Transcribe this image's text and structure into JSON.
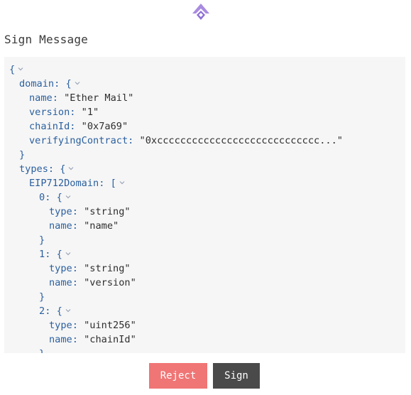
{
  "header": {
    "logo_icon": "diamond-arrow-logo",
    "logo_color": "#a98be0"
  },
  "title": "Sign Message",
  "code": {
    "lines": [
      {
        "indent": 0,
        "key": "",
        "sep": "",
        "value": "{",
        "toggle": true
      },
      {
        "indent": 1,
        "key": "domain",
        "sep": ": ",
        "value": "{",
        "toggle": true
      },
      {
        "indent": 2,
        "key": "name",
        "sep": ": ",
        "value": "\"Ether Mail\"",
        "toggle": false
      },
      {
        "indent": 2,
        "key": "version",
        "sep": ": ",
        "value": "\"1\"",
        "toggle": false
      },
      {
        "indent": 2,
        "key": "chainId",
        "sep": ": ",
        "value": "\"0x7a69\"",
        "toggle": false
      },
      {
        "indent": 2,
        "key": "verifyingContract",
        "sep": ": ",
        "value": "\"0xcccccccccccccccccccccccccccc...\"",
        "toggle": false
      },
      {
        "indent": 1,
        "key": "",
        "sep": "",
        "value": "}",
        "toggle": false
      },
      {
        "indent": 1,
        "key": "types",
        "sep": ": ",
        "value": "{",
        "toggle": true
      },
      {
        "indent": 2,
        "key": "EIP712Domain",
        "sep": ": ",
        "value": "[",
        "toggle": true
      },
      {
        "indent": 3,
        "key": "0",
        "sep": ": ",
        "value": "{",
        "toggle": true
      },
      {
        "indent": 4,
        "key": "type",
        "sep": ": ",
        "value": "\"string\"",
        "toggle": false
      },
      {
        "indent": 4,
        "key": "name",
        "sep": ": ",
        "value": "\"name\"",
        "toggle": false
      },
      {
        "indent": 3,
        "key": "",
        "sep": "",
        "value": "}",
        "toggle": false
      },
      {
        "indent": 3,
        "key": "1",
        "sep": ": ",
        "value": "{",
        "toggle": true
      },
      {
        "indent": 4,
        "key": "type",
        "sep": ": ",
        "value": "\"string\"",
        "toggle": false
      },
      {
        "indent": 4,
        "key": "name",
        "sep": ": ",
        "value": "\"version\"",
        "toggle": false
      },
      {
        "indent": 3,
        "key": "",
        "sep": "",
        "value": "}",
        "toggle": false
      },
      {
        "indent": 3,
        "key": "2",
        "sep": ": ",
        "value": "{",
        "toggle": true
      },
      {
        "indent": 4,
        "key": "type",
        "sep": ": ",
        "value": "\"uint256\"",
        "toggle": false
      },
      {
        "indent": 4,
        "key": "name",
        "sep": ": ",
        "value": "\"chainId\"",
        "toggle": false
      },
      {
        "indent": 3,
        "key": "",
        "sep": "",
        "value": "}",
        "toggle": false
      }
    ]
  },
  "actions": {
    "reject_label": "Reject",
    "sign_label": "Sign",
    "reject_color": "#f07575",
    "sign_color": "#4a4a4a"
  }
}
